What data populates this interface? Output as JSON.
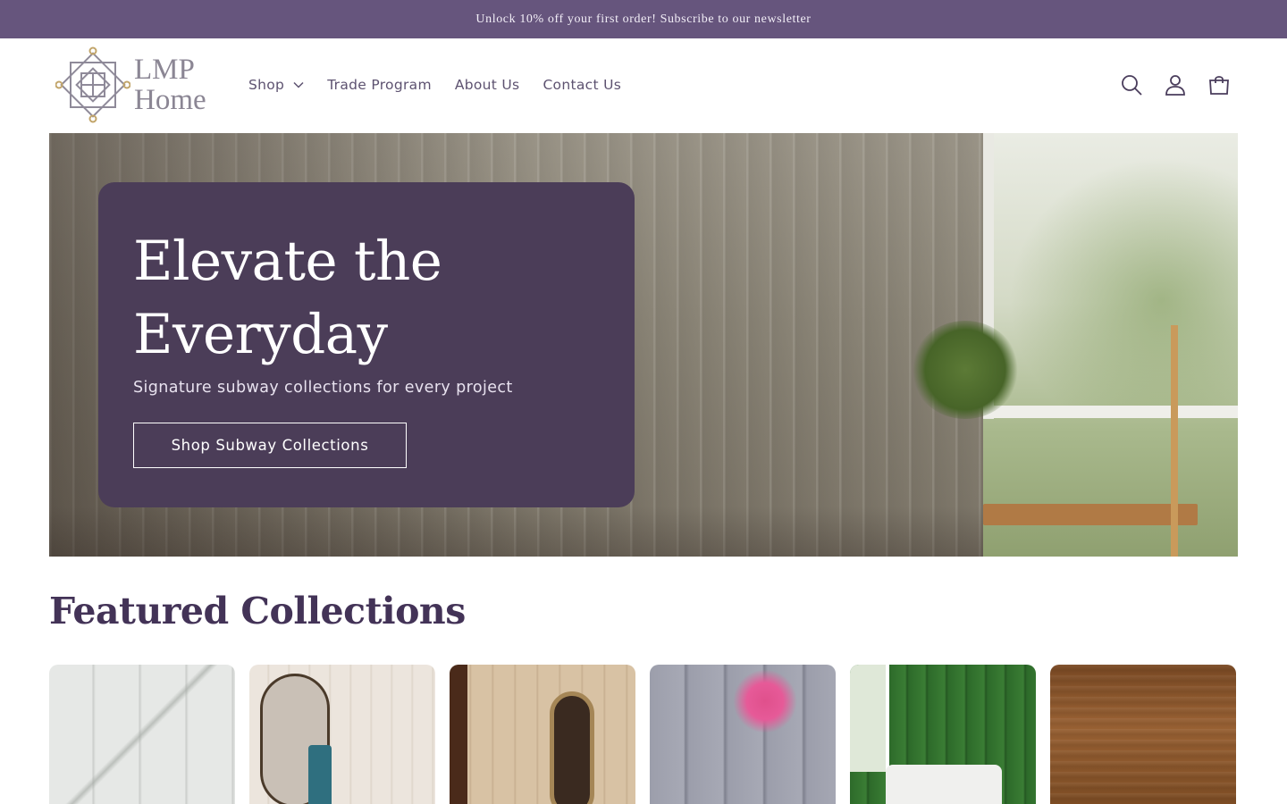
{
  "announcement": {
    "text": "Unlock 10% off your first order! Subscribe to our newsletter"
  },
  "header": {
    "logo": {
      "line1": "LMP",
      "line2": "Home"
    },
    "nav": [
      {
        "label": "Shop",
        "has_dropdown": true
      },
      {
        "label": "Trade Program"
      },
      {
        "label": "About Us"
      },
      {
        "label": "Contact Us"
      }
    ],
    "icons": [
      "search-icon",
      "account-icon",
      "cart-icon"
    ]
  },
  "hero": {
    "title": "Elevate the Everyday",
    "subtitle": "Signature subway collections for every project",
    "button_label": "Shop Subway Collections"
  },
  "featured": {
    "title": "Featured Collections",
    "collections": [
      {
        "name": "collection-white-picket"
      },
      {
        "name": "collection-cream-gloss"
      },
      {
        "name": "collection-beige-stack"
      },
      {
        "name": "collection-grey-picket"
      },
      {
        "name": "collection-green-zellige"
      },
      {
        "name": "collection-wood-look"
      }
    ]
  },
  "colors": {
    "announcement_bg": "#66557d",
    "hero_card_bg": "#4b3d58",
    "heading": "#433357",
    "nav_text": "#5d5270"
  }
}
